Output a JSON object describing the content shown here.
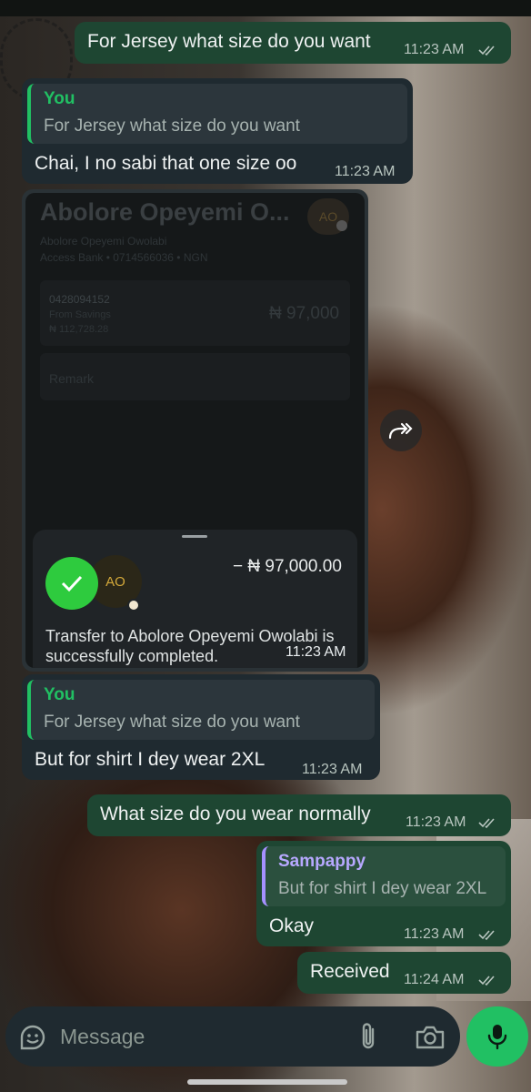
{
  "messages": {
    "m1": {
      "text": "For Jersey what size do you want",
      "time": "11:23 AM"
    },
    "m2": {
      "quote_author": "You",
      "quote_text": "For Jersey what size do you want",
      "text": "Chai, I no sabi that one size oo",
      "time": "11:23 AM"
    },
    "m3": {
      "bank_name": "Abolore Opeyemi O...",
      "bank_avatar": "AO",
      "bank_full_name": "Abolore Opeyemi Owolabi",
      "bank_details": "Access Bank • 0714566036 • NGN",
      "account": "0428094152",
      "from": "From Savings",
      "balance": "₦ 112,728.28",
      "bank_amount": "₦ 97,000",
      "remark": "Remark",
      "avatar": "AO",
      "amount": "− ₦ 97,000.00",
      "transfer_text": "Transfer to Abolore Opeyemi Owolabi is successfully completed.",
      "time": "11:23 AM"
    },
    "m4": {
      "quote_author": "You",
      "quote_text": "For Jersey what size do you want",
      "text": "But for shirt I dey wear 2XL",
      "time": "11:23 AM"
    },
    "m5": {
      "text": "What size do you wear normally",
      "time": "11:23 AM"
    },
    "m6": {
      "quote_author": "Sampappy",
      "quote_text": "But for shirt I dey wear 2XL",
      "text": "Okay",
      "time": "11:23 AM"
    },
    "m7": {
      "text": "Received",
      "time": "11:24 AM"
    }
  },
  "input": {
    "placeholder": "Message"
  },
  "icons": {
    "read": "double-check-icon",
    "forward": "forward-icon",
    "emoji": "sticker-icon",
    "attach": "paperclip-icon",
    "camera": "camera-icon",
    "mic": "microphone-icon",
    "success": "check-icon"
  },
  "colors": {
    "outgoing": "#1e4632",
    "incoming": "#1f2a30",
    "accent": "#21c063",
    "quote_purple": "#a590ff"
  }
}
